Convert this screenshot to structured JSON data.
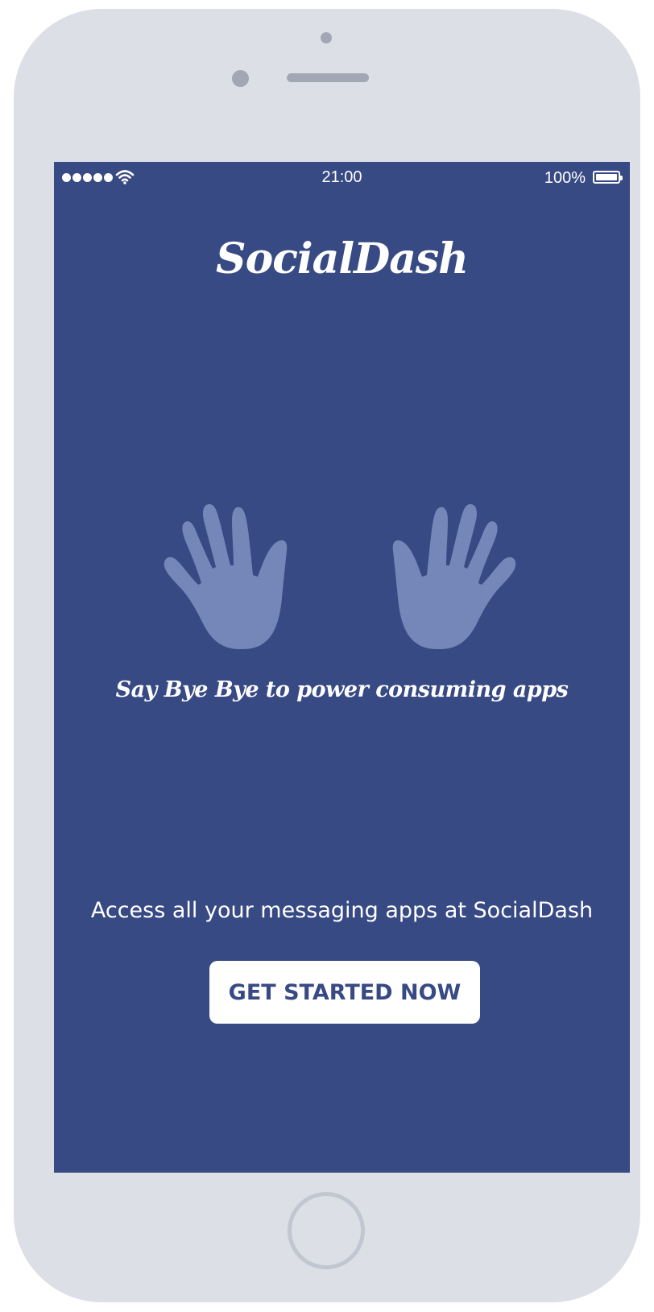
{
  "status_bar": {
    "signal_dots": 5,
    "wifi_icon": "wifi-icon",
    "time": "21:00",
    "battery_percent": "100%",
    "battery_level": 1.0
  },
  "app": {
    "title": "SocialDash",
    "illustration_icon": "waving-hands-icon",
    "tagline": "Say Bye Bye to power consuming apps",
    "description": "Access all your messaging apps at SocialDash",
    "cta_label": "GET STARTED NOW"
  },
  "colors": {
    "screen_background": "#384a84",
    "device_body": "#dcdfe6",
    "hands": "#7586b8",
    "button_background": "#ffffff",
    "button_text": "#384a84"
  }
}
